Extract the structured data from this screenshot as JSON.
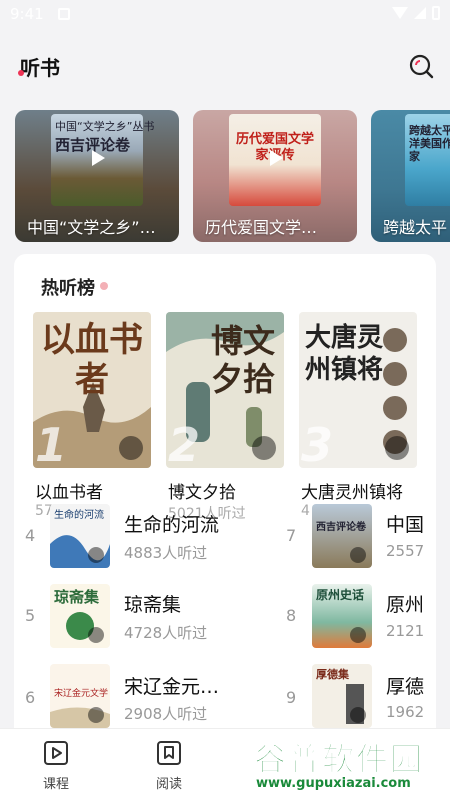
{
  "status": {
    "time": "9:41"
  },
  "header": {
    "title": "听书"
  },
  "featured": [
    {
      "title": "中国“文学之乡”…",
      "thumb_text": "西吉评论卷",
      "thumb_top": "中国“文学之乡”丛书"
    },
    {
      "title": "历代爱国文学…",
      "thumb_text": "历代爱国文学家评传"
    },
    {
      "title": "跨越太平",
      "thumb_text": "跨越太平洋美国作家"
    }
  ],
  "hot": {
    "title": "热听榜",
    "top3": [
      {
        "rank": "1",
        "title": "以血书者",
        "listeners": "57",
        "cover_text": "以血书者"
      },
      {
        "rank": "2",
        "title": "博文夕拾",
        "listeners": "5021人听过",
        "cover_text": "博文夕拾"
      },
      {
        "rank": "3",
        "title": "大唐灵州镇将",
        "listeners": "4",
        "cover_text": "大唐灵州镇将"
      }
    ],
    "list": [
      {
        "rank": "4",
        "title": "生命的河流",
        "listeners": "4883人听过",
        "cover_text": "生命的河流"
      },
      {
        "rank": "5",
        "title": "琼斋集",
        "listeners": "4728人听过",
        "cover_text": "琼斋集"
      },
      {
        "rank": "6",
        "title": "宋辽金元…",
        "listeners": "2908人听过",
        "cover_text": "宋辽金元文学"
      },
      {
        "rank": "7",
        "title": "中国",
        "listeners": "2557",
        "cover_text": "西吉评论卷"
      },
      {
        "rank": "8",
        "title": "原州",
        "listeners": "2121",
        "cover_text": "原州史话"
      },
      {
        "rank": "9",
        "title": "厚德",
        "listeners": "1962",
        "cover_text": "厚德集"
      }
    ]
  },
  "nav": [
    {
      "label": "课程",
      "icon": "play-square-icon"
    },
    {
      "label": "阅读",
      "icon": "bookmark-icon"
    }
  ],
  "watermark": {
    "logo": "谷普软件园",
    "url": "www.gupuxiazai.com"
  }
}
